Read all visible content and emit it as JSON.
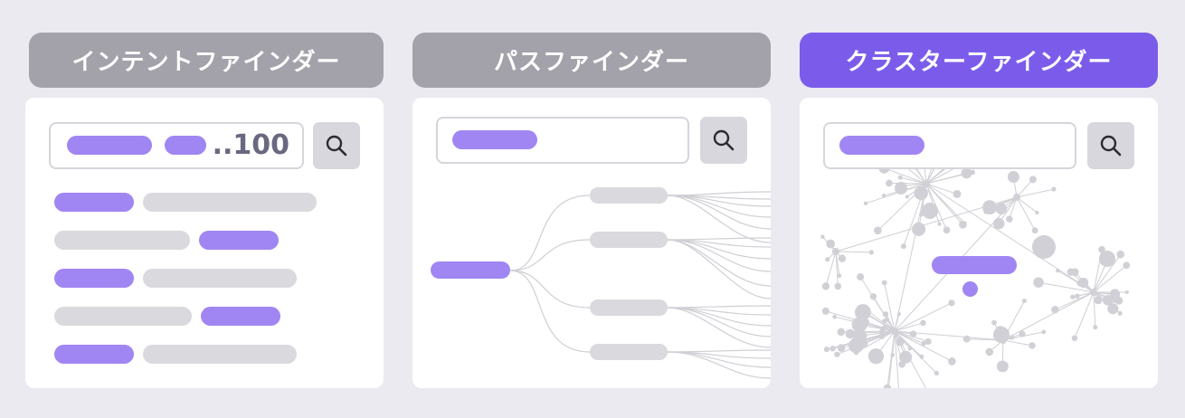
{
  "tabs": {
    "intent": "インテントファインダー",
    "path": "パスファインダー",
    "cluster": "クラスターファインダー"
  },
  "intent_finder": {
    "result_count": "..100"
  },
  "colors": {
    "background": "#ebeaf0",
    "tab_inactive": "#a3a2aa",
    "tab_active": "#7b5cea",
    "accent_pill": "#9f86f2",
    "neutral_pill": "#d9d9de"
  },
  "icons": {
    "search": "search-icon"
  }
}
